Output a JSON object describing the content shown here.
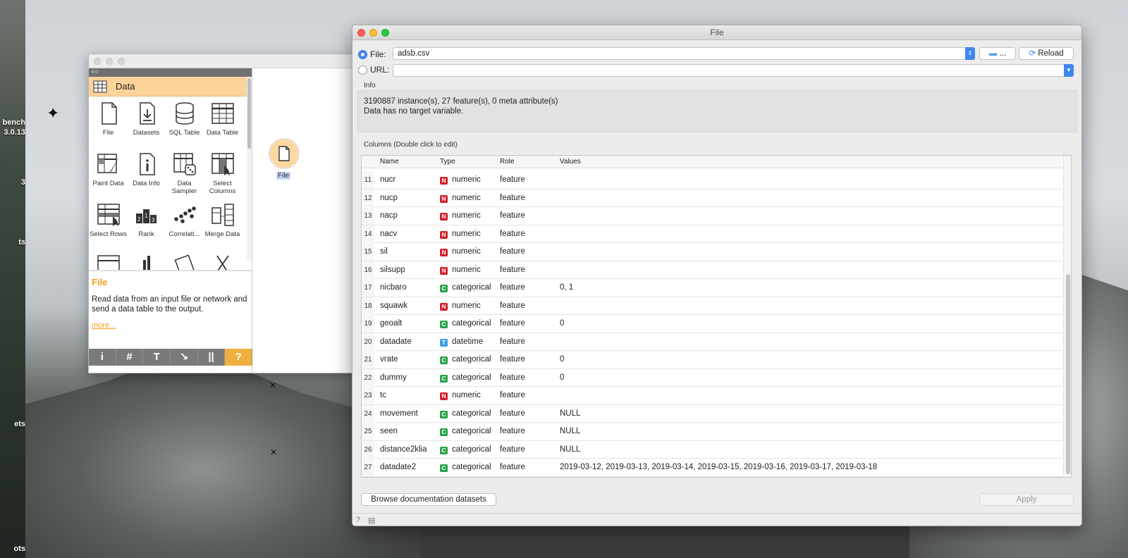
{
  "desktop": {
    "labels": [
      "bench",
      "3.0.13",
      "3",
      "ts",
      "ets",
      "ots"
    ]
  },
  "canvas_window": {
    "toolbox": {
      "collapse_label": "<<",
      "category": "Data",
      "widgets": [
        {
          "label": "File",
          "icon": "file-icon"
        },
        {
          "label": "Datasets",
          "icon": "datasets-icon"
        },
        {
          "label": "SQL Table",
          "icon": "database-icon"
        },
        {
          "label": "Data Table",
          "icon": "table-icon"
        },
        {
          "label": "Paint Data",
          "icon": "paint-icon"
        },
        {
          "label": "Data Info",
          "icon": "info-icon"
        },
        {
          "label": "Data Sampler",
          "icon": "sampler-icon"
        },
        {
          "label": "Select Columns",
          "icon": "select-columns-icon"
        },
        {
          "label": "Select Rows",
          "icon": "select-rows-icon"
        },
        {
          "label": "Rank",
          "icon": "rank-icon"
        },
        {
          "label": "Correlati...",
          "icon": "correlation-icon"
        },
        {
          "label": "Merge Data",
          "icon": "merge-icon"
        }
      ],
      "description": {
        "title": "File",
        "text": "Read data from an input file or network and send a data table to the output.",
        "more": "more..."
      },
      "bottom_buttons": [
        "i",
        "#",
        "T",
        "↘",
        "||",
        "?"
      ]
    },
    "node": {
      "label": "File"
    }
  },
  "file_dialog": {
    "title": "File",
    "file_radio_label": "File:",
    "file_value": "adsb.csv",
    "browse_button": "...",
    "reload_button": "Reload",
    "url_radio_label": "URL:",
    "url_value": "",
    "info_label": "Info",
    "info_line1": "3190887 instance(s), 27 feature(s), 0 meta attribute(s)",
    "info_line2": "Data has no target variable.",
    "columns_label": "Columns (Double click to edit)",
    "headers": {
      "name": "Name",
      "type": "Type",
      "role": "Role",
      "values": "Values"
    },
    "rows": [
      {
        "num": "11",
        "name": "nucr",
        "badge": "N",
        "type": "numeric",
        "role": "feature",
        "values": ""
      },
      {
        "num": "12",
        "name": "nucp",
        "badge": "N",
        "type": "numeric",
        "role": "feature",
        "values": ""
      },
      {
        "num": "13",
        "name": "nacp",
        "badge": "N",
        "type": "numeric",
        "role": "feature",
        "values": ""
      },
      {
        "num": "14",
        "name": "nacv",
        "badge": "N",
        "type": "numeric",
        "role": "feature",
        "values": ""
      },
      {
        "num": "15",
        "name": "sil",
        "badge": "N",
        "type": "numeric",
        "role": "feature",
        "values": ""
      },
      {
        "num": "16",
        "name": "silsupp",
        "badge": "N",
        "type": "numeric",
        "role": "feature",
        "values": ""
      },
      {
        "num": "17",
        "name": "nicbaro",
        "badge": "C",
        "type": "categorical",
        "role": "feature",
        "values": "0, 1"
      },
      {
        "num": "18",
        "name": "squawk",
        "badge": "N",
        "type": "numeric",
        "role": "feature",
        "values": ""
      },
      {
        "num": "19",
        "name": "geoalt",
        "badge": "C",
        "type": "categorical",
        "role": "feature",
        "values": "0"
      },
      {
        "num": "20",
        "name": "datadate",
        "badge": "T",
        "type": "datetime",
        "role": "feature",
        "values": ""
      },
      {
        "num": "21",
        "name": "vrate",
        "badge": "C",
        "type": "categorical",
        "role": "feature",
        "values": "0"
      },
      {
        "num": "22",
        "name": "dummy",
        "badge": "C",
        "type": "categorical",
        "role": "feature",
        "values": "0"
      },
      {
        "num": "23",
        "name": "tc",
        "badge": "N",
        "type": "numeric",
        "role": "feature",
        "values": ""
      },
      {
        "num": "24",
        "name": "movement",
        "badge": "C",
        "type": "categorical",
        "role": "feature",
        "values": "NULL"
      },
      {
        "num": "25",
        "name": "seen",
        "badge": "C",
        "type": "categorical",
        "role": "feature",
        "values": "NULL"
      },
      {
        "num": "26",
        "name": "distance2klia",
        "badge": "C",
        "type": "categorical",
        "role": "feature",
        "values": "NULL"
      },
      {
        "num": "27",
        "name": "datadate2",
        "badge": "C",
        "type": "categorical",
        "role": "feature",
        "values": "2019-03-12, 2019-03-13, 2019-03-14, 2019-03-15, 2019-03-16, 2019-03-17, 2019-03-18"
      }
    ],
    "badge_colors": {
      "N": "#d0202a",
      "C": "#2aa34a",
      "T": "#3a9fe0"
    },
    "browse_docs_button": "Browse documentation datasets",
    "apply_button": "Apply"
  }
}
